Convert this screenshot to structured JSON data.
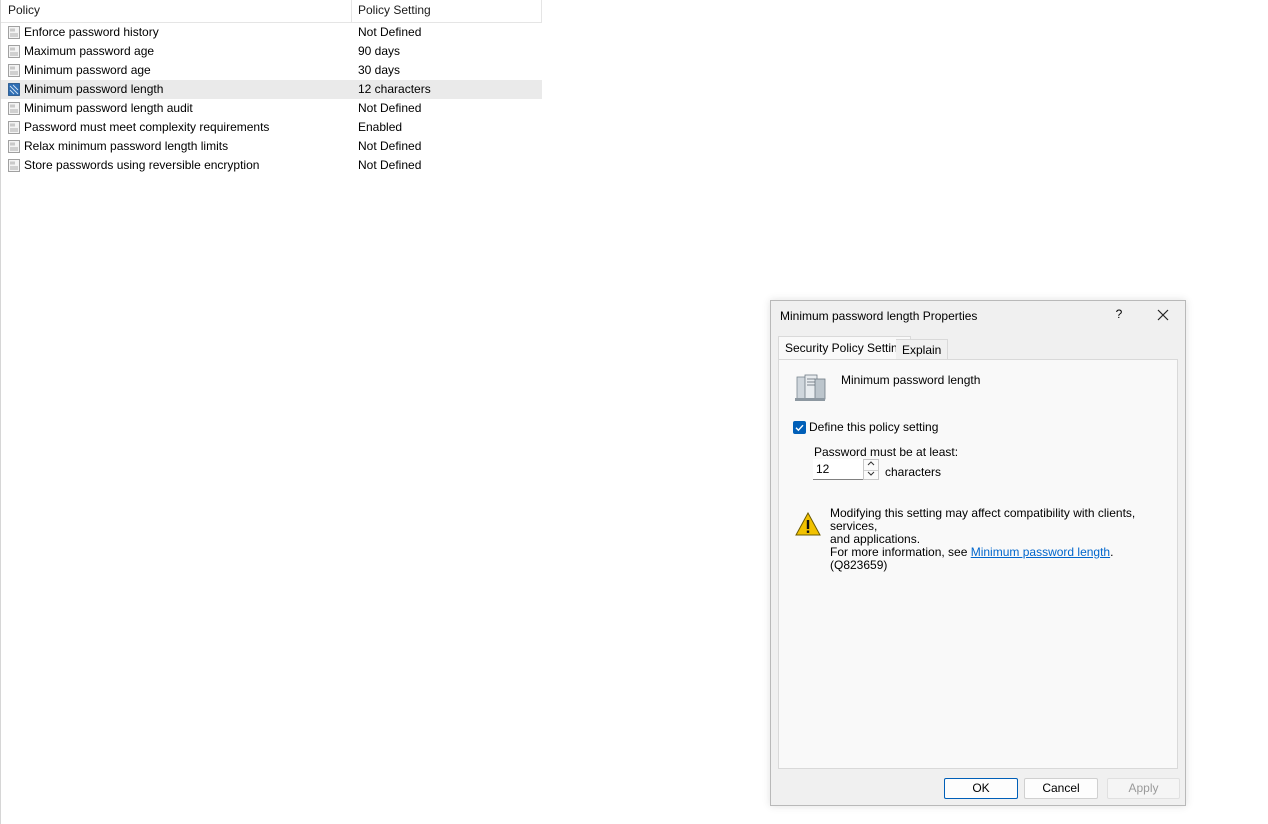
{
  "list": {
    "columns": {
      "policy": "Policy",
      "setting": "Policy Setting"
    },
    "rows": [
      {
        "name": "Enforce password history",
        "value": "Not Defined"
      },
      {
        "name": "Maximum password age",
        "value": "90 days"
      },
      {
        "name": "Minimum password age",
        "value": "30 days"
      },
      {
        "name": "Minimum password length",
        "value": "12 characters"
      },
      {
        "name": "Minimum password length audit",
        "value": "Not Defined"
      },
      {
        "name": "Password must meet complexity requirements",
        "value": "Enabled"
      },
      {
        "name": "Relax minimum password length limits",
        "value": "Not Defined"
      },
      {
        "name": "Store passwords using reversible encryption",
        "value": "Not Defined"
      }
    ],
    "selected_index": 3
  },
  "dialog": {
    "title": "Minimum password length Properties",
    "help": "?",
    "tabs": {
      "active": "Security Policy Setting",
      "inactive": "Explain"
    },
    "policy_name": "Minimum password length",
    "define_label": "Define this policy setting",
    "define_checked": true,
    "min_label": "Password must be at least:",
    "min_value": "12",
    "units": "characters",
    "warning": {
      "line1": "Modifying this setting may affect compatibility with clients, services,",
      "line2": "and applications.",
      "line3_prefix": "For more information, see ",
      "link": "Minimum password length",
      "line3_suffix": ". (Q823659)"
    },
    "buttons": {
      "ok": "OK",
      "cancel": "Cancel",
      "apply": "Apply"
    }
  },
  "colors": {
    "accent": "#005fb8",
    "link": "#0066cc",
    "selected_row": "#eaeaea"
  },
  "icons": {
    "policy_row": "policy-setting-icon",
    "dialog_policy": "server-icon",
    "warning": "warning-icon"
  }
}
